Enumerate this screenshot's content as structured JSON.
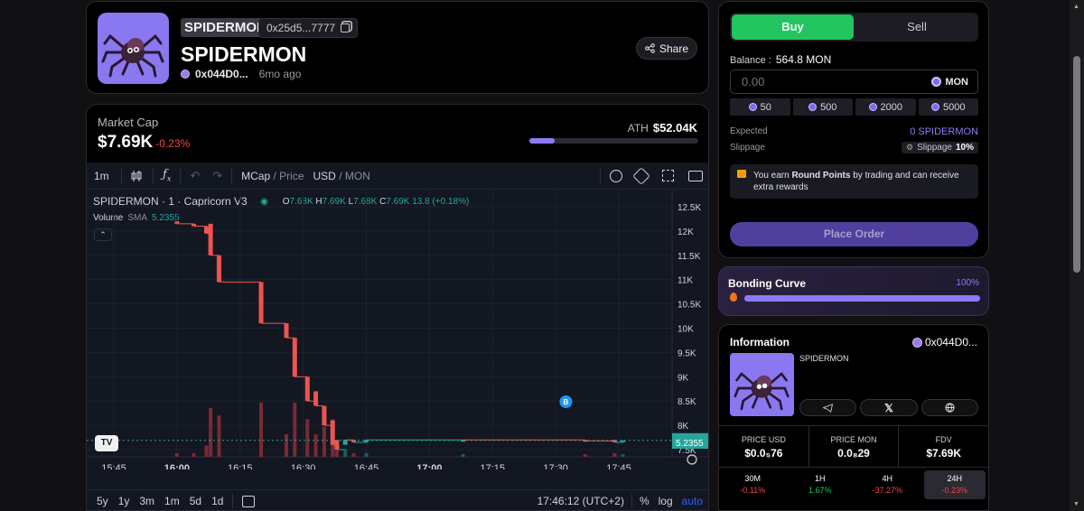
{
  "token": {
    "ticker_badge": "SPIDERMON",
    "address_short": "0x25d5...7777",
    "name": "SPIDERMON",
    "creator_short": "0x044D0...",
    "age": "6mo ago",
    "share_label": "Share"
  },
  "market": {
    "label": "Market Cap",
    "value": "$7.69K",
    "change": "-0.23%",
    "ath_label": "ATH",
    "ath_value": "$52.04K",
    "ath_progress_fraction": 0.15
  },
  "chart_toolbar": {
    "interval": "1m",
    "fx": "fx",
    "mcap": "MCap",
    "slash1": " / ",
    "price": "Price",
    "usd": "USD",
    "slash2": " / ",
    "mon": "MON"
  },
  "chart_legend": {
    "symbol": "SPIDERMON · 1 · Capricorn V3",
    "o_label": "O",
    "o_val": "7.68K",
    "h_label": "H",
    "h_val": "7.69K",
    "l_label": "L",
    "l_val": "7.68K",
    "c_label": "C",
    "c_val": "7.69K",
    "change": "13.8 (+0.18%)",
    "volume_label": "Volume",
    "sma_label": "SMA",
    "sma_val": "5.2355"
  },
  "chart_data": {
    "type": "candlestick",
    "y_ticks": [
      "12.5K",
      "12K",
      "11.5K",
      "11K",
      "10.5K",
      "10K",
      "9.5K",
      "9K",
      "8.5K",
      "8K",
      "7.5K"
    ],
    "x_ticks": [
      "15:45",
      "16:00",
      "16:15",
      "16:30",
      "16:45",
      "17:00",
      "17:15",
      "17:30",
      "17:45"
    ],
    "price_label": "7.69K",
    "volume_label": "5.2355",
    "marker": "B",
    "candles": [
      {
        "t": "16:00",
        "o": 12200,
        "c": 12150
      },
      {
        "t": "16:04",
        "o": 12150,
        "c": 12100
      },
      {
        "t": "16:07",
        "o": 12100,
        "c": 11950
      },
      {
        "t": "16:08",
        "o": 12150,
        "c": 11500
      },
      {
        "t": "16:10",
        "o": 11500,
        "c": 10950
      },
      {
        "t": "16:20",
        "o": 10950,
        "c": 10100
      },
      {
        "t": "16:26",
        "o": 10100,
        "c": 9800
      },
      {
        "t": "16:28",
        "o": 9800,
        "c": 9000
      },
      {
        "t": "16:31",
        "o": 9000,
        "c": 8500
      },
      {
        "t": "16:33",
        "o": 8700,
        "c": 8400
      },
      {
        "t": "16:35",
        "o": 8400,
        "c": 8000
      },
      {
        "t": "16:37",
        "o": 8100,
        "c": 7600
      },
      {
        "t": "16:38",
        "o": 7700,
        "c": 7500
      },
      {
        "t": "16:40",
        "o": 7600,
        "c": 7700
      },
      {
        "t": "16:42",
        "o": 7700,
        "c": 7650
      },
      {
        "t": "16:45",
        "o": 7650,
        "c": 7700
      },
      {
        "t": "17:08",
        "o": 7690,
        "c": 7700
      },
      {
        "t": "17:37",
        "o": 7700,
        "c": 7680
      },
      {
        "t": "17:44",
        "o": 7700,
        "c": 7650
      },
      {
        "t": "17:46",
        "o": 7680,
        "c": 7690
      }
    ]
  },
  "chart_footer": {
    "ranges": [
      "5y",
      "1y",
      "3m",
      "1m",
      "5d",
      "1d"
    ],
    "time": "17:46:12 (UTC+2)",
    "pct": "%",
    "log": "log",
    "auto": "auto"
  },
  "trade": {
    "buy_label": "Buy",
    "sell_label": "Sell",
    "balance_label": "Balance :",
    "balance_value": "564.8 MON",
    "amount_placeholder": "0.00",
    "currency": "MON",
    "presets": [
      "50",
      "500",
      "2000",
      "5000"
    ],
    "expected_label": "Expected",
    "expected_value": "0 SPIDERMON",
    "slippage_label": "Slippage",
    "slippage_chip_label": "Slippage",
    "slippage_value": "10%",
    "notice_prefix": "You earn ",
    "notice_bold": "Round Points",
    "notice_suffix": " by trading and can receive extra rewards",
    "place_order": "Place Order"
  },
  "bonding": {
    "label": "Bonding Curve",
    "percent": "100%",
    "progress_fraction": 1.0
  },
  "info": {
    "title": "Information",
    "creator": "0x044D0...",
    "name": "SPIDERMON",
    "stats": [
      {
        "label": "PRICE USD",
        "value": "$0.0₅76"
      },
      {
        "label": "PRICE MON",
        "value": "0.0₈29"
      },
      {
        "label": "FDV",
        "value": "$7.69K"
      }
    ],
    "changes": [
      {
        "label": "30M",
        "value": "-0.11%",
        "dir": "down"
      },
      {
        "label": "1H",
        "value": "1.67%",
        "dir": "up"
      },
      {
        "label": "4H",
        "value": "-37.27%",
        "dir": "down"
      },
      {
        "label": "24H",
        "value": "-0.23%",
        "dir": "down"
      }
    ]
  },
  "colors": {
    "buy_green": "#22c55e",
    "accent_purple": "#7c6cf2",
    "down_red": "#f04747"
  }
}
